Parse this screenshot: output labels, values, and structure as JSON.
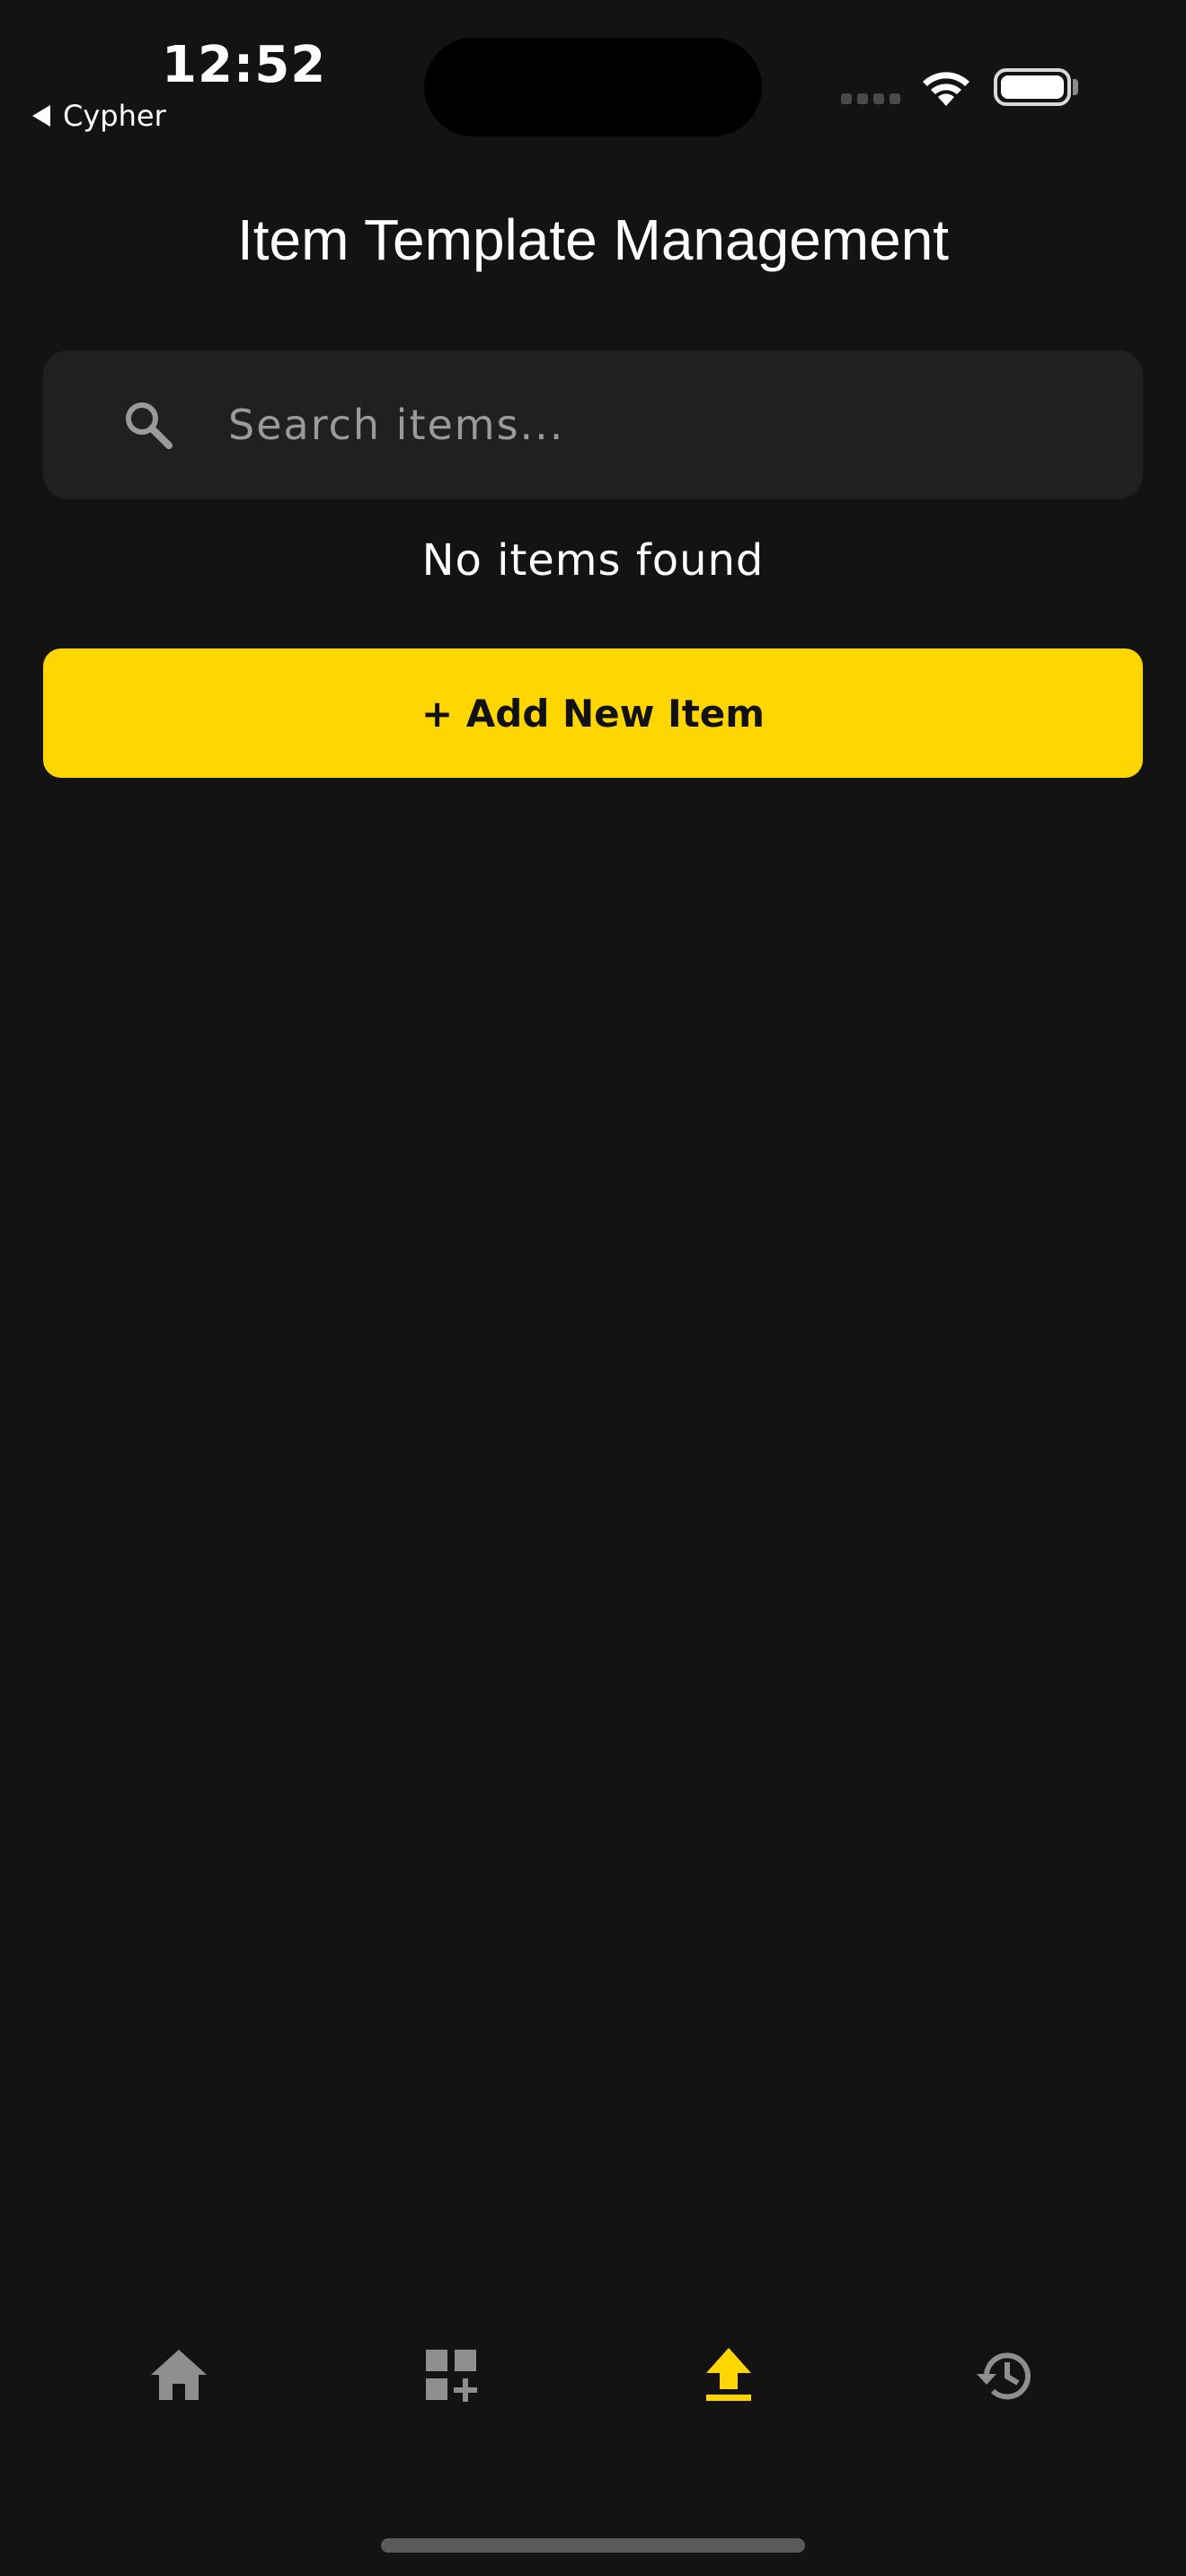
{
  "status_bar": {
    "time": "12:52",
    "back_label": "Cypher"
  },
  "header": {
    "title": "Item Template Management"
  },
  "search": {
    "placeholder": "Search items...",
    "value": ""
  },
  "list": {
    "empty_message": "No items found"
  },
  "actions": {
    "add_label": "+ Add New Item"
  },
  "tab_bar": {
    "items": [
      {
        "icon": "home-icon",
        "active": false
      },
      {
        "icon": "dashboard-add-icon",
        "active": false
      },
      {
        "icon": "upload-icon",
        "active": true
      },
      {
        "icon": "history-icon",
        "active": false
      }
    ]
  },
  "colors": {
    "background": "#131313",
    "accent": "#ffd600",
    "inactive_icon": "#8f8f8f",
    "search_bg": "#202020"
  }
}
